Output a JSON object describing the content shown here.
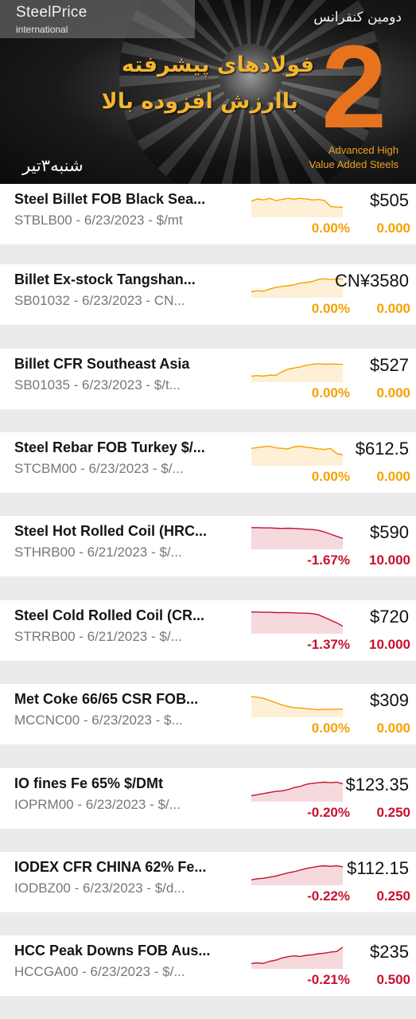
{
  "banner": {
    "logo_name": "SteelPrice",
    "logo_sub": "international",
    "conference_title": "دومین کنفرانس",
    "headline_line1": "فولادهای پیشرفته",
    "headline_line2": "باارزش افزوده بالا",
    "edition_number": "2",
    "subtitle_line1": "Advanced High",
    "subtitle_line2": "Value Added Steels",
    "date_fa": "شنبه۳تیر",
    "colors": {
      "gold": "#f3b531",
      "orange": "#e8731e"
    }
  },
  "colors": {
    "flat": "#f5a100",
    "down": "#c8102e",
    "row_bg": "#ffffff",
    "page_bg": "#ebebeb"
  },
  "rows": [
    {
      "name": "Steel Billet FOB Black Sea...",
      "code": "STBLB00 - 6/23/2023 - $/mt",
      "price": "$505",
      "pct": "0.00%",
      "change": "0.000",
      "trend": "flat",
      "spark": [
        0.4,
        0.32,
        0.36,
        0.3,
        0.38,
        0.34,
        0.3,
        0.33,
        0.3,
        0.32,
        0.36,
        0.34,
        0.38,
        0.6,
        0.62,
        0.63
      ]
    },
    {
      "name": "Billet Ex-stock Tangshan...",
      "code": "SB01032 - 6/23/2023 - CN...",
      "price": "CN¥3580",
      "pct": "0.00%",
      "change": "0.000",
      "trend": "flat",
      "spark": [
        0.78,
        0.74,
        0.76,
        0.68,
        0.62,
        0.58,
        0.56,
        0.52,
        0.46,
        0.44,
        0.4,
        0.32,
        0.3,
        0.33,
        0.3,
        0.31
      ]
    },
    {
      "name": "Billet CFR Southeast Asia",
      "code": "SB01035 - 6/23/2023 - $/t...",
      "price": "$527",
      "pct": "0.00%",
      "change": "0.000",
      "trend": "flat",
      "spark": [
        0.78,
        0.76,
        0.78,
        0.74,
        0.75,
        0.62,
        0.52,
        0.48,
        0.44,
        0.38,
        0.34,
        0.32,
        0.34,
        0.33,
        0.34,
        0.34
      ]
    },
    {
      "name": "Steel Rebar FOB Turkey $/...",
      "code": "STCBM00 - 6/23/2023 - $/...",
      "price": "$612.5",
      "pct": "0.00%",
      "change": "0.000",
      "trend": "flat",
      "spark": [
        0.36,
        0.33,
        0.3,
        0.28,
        0.34,
        0.36,
        0.38,
        0.3,
        0.28,
        0.32,
        0.34,
        0.38,
        0.4,
        0.36,
        0.55,
        0.6
      ]
    },
    {
      "name": "Steel Hot Rolled Coil (HRC...",
      "code": "STHRB00 - 6/21/2023 - $/...",
      "price": "$590",
      "pct": "-1.67%",
      "change": "10.000",
      "trend": "down",
      "spark": [
        0.2,
        0.2,
        0.21,
        0.21,
        0.22,
        0.23,
        0.22,
        0.23,
        0.24,
        0.26,
        0.27,
        0.3,
        0.36,
        0.44,
        0.52,
        0.6
      ]
    },
    {
      "name": "Steel Cold Rolled Coil (CR...",
      "code": "STRRB00 - 6/21/2023 - $/...",
      "price": "$720",
      "pct": "-1.37%",
      "change": "10.000",
      "trend": "down",
      "spark": [
        0.2,
        0.2,
        0.21,
        0.21,
        0.22,
        0.22,
        0.22,
        0.23,
        0.24,
        0.24,
        0.26,
        0.3,
        0.4,
        0.5,
        0.6,
        0.72
      ]
    },
    {
      "name": "Met Coke 66/65 CSR FOB...",
      "code": "MCCNC00 - 6/23/2023 - $...",
      "price": "$309",
      "pct": "0.00%",
      "change": "0.000",
      "trend": "flat",
      "spark": [
        0.24,
        0.26,
        0.3,
        0.38,
        0.46,
        0.54,
        0.6,
        0.64,
        0.66,
        0.68,
        0.7,
        0.72,
        0.7,
        0.71,
        0.7,
        0.7
      ]
    },
    {
      "name": "IO fines Fe 65% $/DMt",
      "code": "IOPRM00 - 6/23/2023 - $/...",
      "price": "$123.35",
      "pct": "-0.20%",
      "change": "0.250",
      "trend": "down",
      "spark": [
        0.78,
        0.74,
        0.7,
        0.66,
        0.62,
        0.6,
        0.56,
        0.48,
        0.44,
        0.36,
        0.32,
        0.3,
        0.28,
        0.3,
        0.28,
        0.34
      ]
    },
    {
      "name": "IODEX CFR CHINA 62% Fe...",
      "code": "IODBZ00 - 6/23/2023 - $/d...",
      "price": "$112.15",
      "pct": "-0.22%",
      "change": "0.250",
      "trend": "down",
      "spark": [
        0.8,
        0.76,
        0.74,
        0.7,
        0.66,
        0.6,
        0.54,
        0.5,
        0.44,
        0.38,
        0.34,
        0.3,
        0.28,
        0.3,
        0.28,
        0.32
      ]
    },
    {
      "name": "HCC Peak Downs FOB Aus...",
      "code": "HCCGA00 - 6/23/2023 - $/...",
      "price": "$235",
      "pct": "-0.21%",
      "change": "0.500",
      "trend": "down",
      "spark": [
        0.8,
        0.78,
        0.8,
        0.72,
        0.68,
        0.6,
        0.55,
        0.52,
        0.54,
        0.5,
        0.48,
        0.44,
        0.42,
        0.38,
        0.36,
        0.2
      ]
    }
  ]
}
